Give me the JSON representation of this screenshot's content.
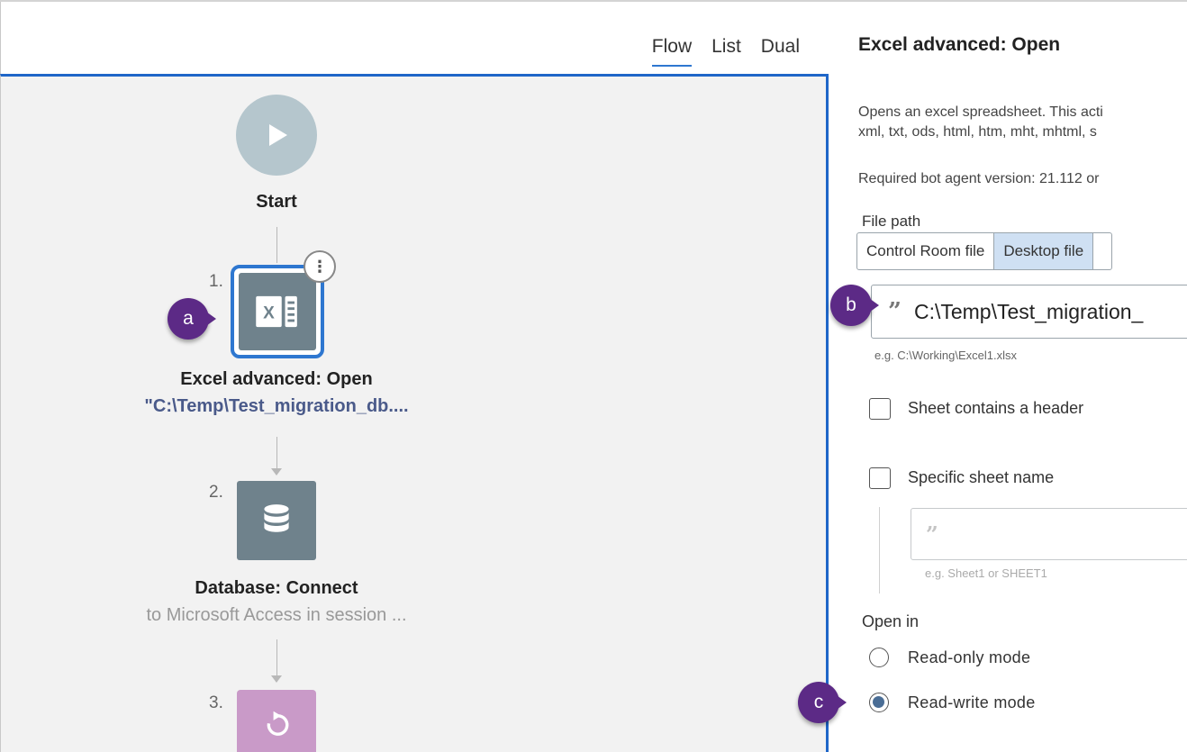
{
  "tabs": [
    {
      "label": "Flow",
      "active": true
    },
    {
      "label": "List",
      "active": false
    },
    {
      "label": "Dual",
      "active": false
    }
  ],
  "flow": {
    "start": {
      "label": "Start",
      "icon": "play-icon"
    },
    "steps": [
      {
        "num": "1.",
        "title": "Excel advanced: Open",
        "subtitle": "\"C:\\Temp\\Test_migration_db....",
        "icon": "excel-icon",
        "selected": true
      },
      {
        "num": "2.",
        "title": "Database: Connect",
        "subtitle": "to Microsoft Access in session ...",
        "icon": "database-icon",
        "selected": false
      },
      {
        "num": "3.",
        "title": "",
        "subtitle": "",
        "icon": "loop-icon",
        "selected": false
      }
    ]
  },
  "callouts": {
    "a": "a",
    "b": "b",
    "c": "c"
  },
  "panel": {
    "title": "Excel advanced: Open",
    "description_line1": "Opens an excel spreadsheet. This acti",
    "description_line2": "xml, txt, ods, html, htm, mht, mhtml, s",
    "required_version": "Required bot agent version: 21.112 or",
    "file_path_label": "File path",
    "file_source_options": [
      "Control Room file",
      "Desktop file"
    ],
    "file_source_selected": "Desktop file",
    "file_path_value": "C:\\Temp\\Test_migration_",
    "file_path_hint": "e.g. C:\\Working\\Excel1.xlsx",
    "header_checkbox_label": "Sheet contains a header",
    "header_checked": false,
    "sheet_name_checkbox_label": "Specific sheet name",
    "sheet_name_checked": false,
    "sheet_name_hint": "e.g. Sheet1 or SHEET1",
    "open_in_label": "Open in",
    "open_modes": [
      {
        "label": "Read-only mode",
        "selected": false
      },
      {
        "label": "Read-write mode",
        "selected": true
      }
    ],
    "colors": {
      "accent": "#1f66c8",
      "callout": "#5c2a86",
      "selected_segment": "#cfe0f3"
    }
  }
}
